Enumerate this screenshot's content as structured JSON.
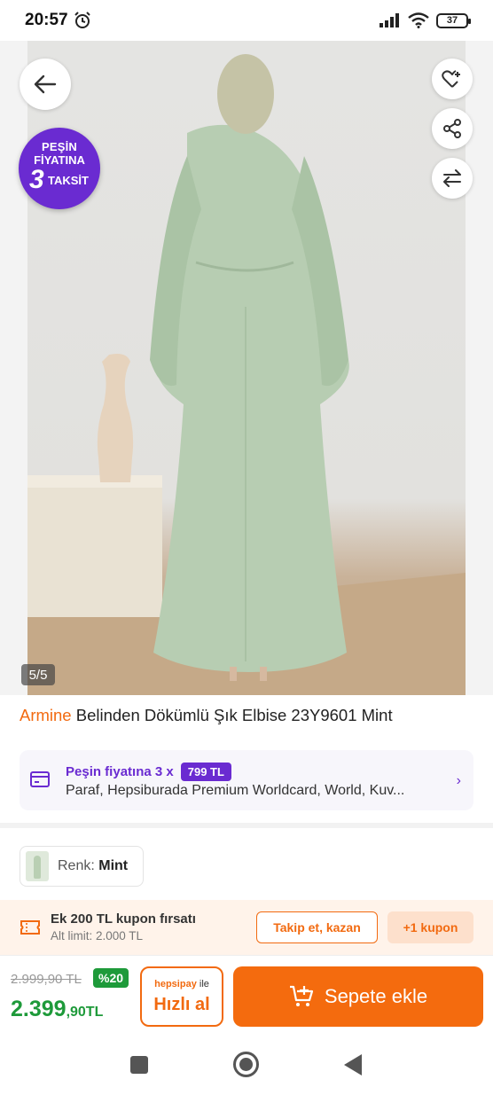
{
  "status_bar": {
    "time": "20:57",
    "battery": "37"
  },
  "hero": {
    "badge": {
      "line1": "PEŞİN",
      "line2": "FİYATINA",
      "number": "3",
      "line3": "TAKSİT"
    },
    "image_counter": "5/5",
    "icons": [
      "back-arrow-icon",
      "heart-icon",
      "share-icon",
      "compare-icon"
    ]
  },
  "product": {
    "brand": "Armine",
    "name": " Belinden Dökümlü Şık Elbise 23Y9601 Mint"
  },
  "installment": {
    "label": "Peşin fiyatına 3 x",
    "amount": "799 TL",
    "cards": "Paraf, Hepsiburada Premium Worldcard, World, Kuv..."
  },
  "color": {
    "label": "Renk: ",
    "value": "Mint"
  },
  "coupon": {
    "title": "Ek 200 TL kupon fırsatı",
    "subtitle": "Alt limit: 2.000 TL",
    "follow_button": "Takip et, kazan",
    "coupon_button": "+1 kupon"
  },
  "buy": {
    "old_price": "2.999,90 TL",
    "discount": "%20",
    "price_main": "2.399",
    "price_decimal": ",90TL",
    "quick_brand": "hepsipay",
    "quick_with": " ile",
    "quick_label": "Hızlı al",
    "add_to_cart": "Sepete ekle"
  },
  "colors": {
    "accent": "#f46b0e",
    "purple": "#6a2bd1",
    "green": "#1e9a3a"
  }
}
